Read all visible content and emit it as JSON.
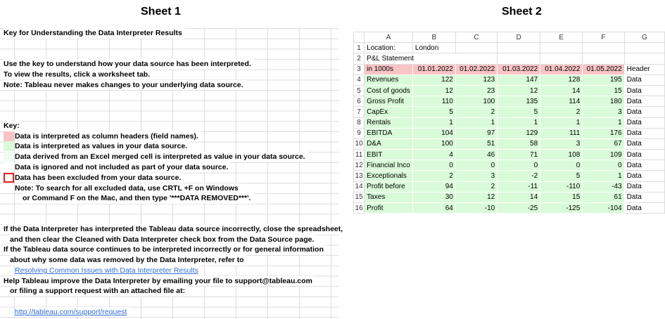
{
  "sheet1": {
    "title": "Sheet 1",
    "heading": "Key for Understanding the Data Interpreter Results",
    "intro": [
      "Use the key to understand how your data source has been interpreted.",
      "To view the results, click a worksheet tab.",
      "Note: Tableau never makes changes to your underlying data source."
    ],
    "key_label": "Key:",
    "key_items": [
      {
        "text": "Data is interpreted as column headers (field names).",
        "color": "#f9c4c4"
      },
      {
        "text": "Data is interpreted as values in your data source.",
        "color": "#d9fbd9"
      },
      {
        "text": "Data derived from an Excel merged cell is interpreted as value in your data source.",
        "color": "#f1fdf1"
      },
      {
        "text": "Data is ignored and not included as part of your data source.",
        "color": "#ffffff"
      },
      {
        "text": "Data has been excluded from your data source.",
        "color": "#e02020"
      }
    ],
    "note1": "Note: To search for all excluded data, use CRTL +F on Windows",
    "note2": "or Command F on the Mac, and then type '***DATA REMOVED***'.",
    "para1a": "If the Data Interpreter has interpreted the Tableau data source incorrectly, close the spreadsheet,",
    "para1b": "and then clear the Cleaned with Data Interpreter check box from the Data Source page.",
    "para2a": "If the Tableau data source continues to be interpreted incorrectly or for general information",
    "para2b": "about why some data was removed by the Data Interpreter, refer to",
    "link1": "Resolving Common Issues with Data Interpreter Results",
    "para3a": "Help Tableau improve the Data Interpreter by emailing your file to support@tableau.com",
    "para3b": "or filing a support request with an attached file at:",
    "link2": "http://tableau.com/support/request"
  },
  "sheet2": {
    "title": "Sheet 2",
    "columns": [
      "A",
      "B",
      "C",
      "D",
      "E",
      "F",
      "G"
    ],
    "row1": {
      "label": "Location:",
      "value": "London"
    },
    "row2": "P&L Statement",
    "header": [
      "in 1000s",
      "01.01.2022",
      "01.02.2022",
      "01.03.2022",
      "01.04.2022",
      "01.05.2022",
      "Header"
    ],
    "rows": [
      [
        "Revenues",
        "122",
        "123",
        "147",
        "128",
        "195",
        "Data"
      ],
      [
        "Cost of goods",
        "12",
        "23",
        "12",
        "14",
        "15",
        "Data"
      ],
      [
        "Gross Profit",
        "110",
        "100",
        "135",
        "114",
        "180",
        "Data"
      ],
      [
        "CapEx",
        "5",
        "2",
        "5",
        "2",
        "3",
        "Data"
      ],
      [
        "Rentals",
        "1",
        "1",
        "1",
        "1",
        "1",
        "Data"
      ],
      [
        "EBITDA",
        "104",
        "97",
        "129",
        "111",
        "176",
        "Data"
      ],
      [
        "D&A",
        "100",
        "51",
        "58",
        "3",
        "67",
        "Data"
      ],
      [
        "EBIT",
        "4",
        "46",
        "71",
        "108",
        "109",
        "Data"
      ],
      [
        "Financial Inco",
        "0",
        "0",
        "0",
        "0",
        "0",
        "Data"
      ],
      [
        "Exceptionals",
        "2",
        "3",
        "-2",
        "5",
        "1",
        "Data"
      ],
      [
        "Profit before",
        "94",
        "2",
        "-11",
        "-110",
        "-43",
        "Data"
      ],
      [
        "Taxes",
        "30",
        "12",
        "14",
        "15",
        "61",
        "Data"
      ],
      [
        "Profit",
        "64",
        "-10",
        "-25",
        "-125",
        "-104",
        "Data"
      ]
    ]
  }
}
